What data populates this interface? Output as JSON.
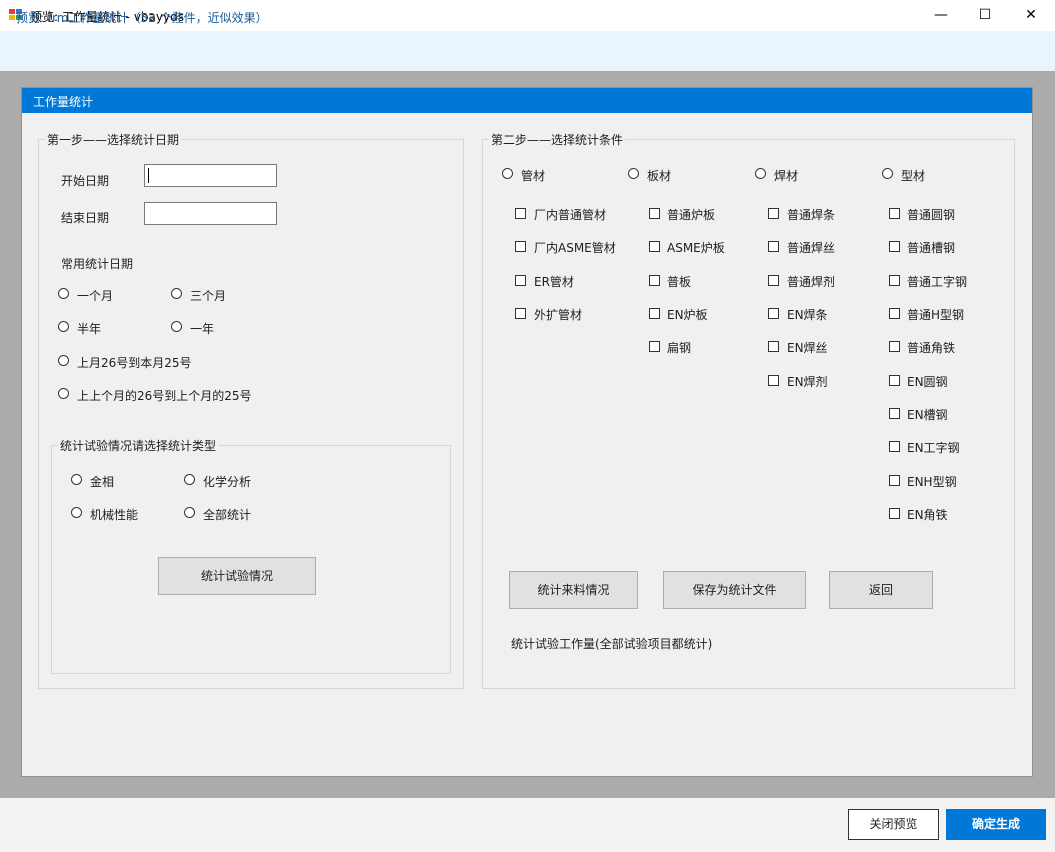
{
  "window": {
    "title": "预览: 工作量统计 - vbayyds",
    "minimize": "—",
    "maximize": "☐",
    "close": "✕"
  },
  "infobar": {
    "text": "预览: frm工作量统计（52 个控件，近似效果）"
  },
  "form": {
    "title": "工作量统计",
    "step1": {
      "title": "第一步——选择统计日期",
      "start_label": "开始日期",
      "start_value": "",
      "end_label": "结束日期",
      "end_value": "",
      "common_label": "常用统计日期",
      "ranges": [
        "一个月",
        "三个月",
        "半年",
        "一年",
        "上月26号到本月25号",
        "上上个月的26号到上个月的25号"
      ],
      "test": {
        "title": "统计试验情况请选择统计类型",
        "options": [
          "金相",
          "化学分析",
          "机械性能",
          "全部统计"
        ],
        "button": "统计试验情况"
      }
    },
    "step2": {
      "title": "第二步——选择统计条件",
      "categories": [
        "管材",
        "板材",
        "焊材",
        "型材"
      ],
      "pipe_items": [
        "厂内普通管材",
        "厂内ASME管材",
        "ER管材",
        "外扩管材"
      ],
      "plate_items": [
        "普通炉板",
        "ASME炉板",
        "普板",
        "EN炉板",
        "扁钢"
      ],
      "weld_items": [
        "普通焊条",
        "普通焊丝",
        "普通焊剂",
        "EN焊条",
        "EN焊丝",
        "EN焊剂"
      ],
      "profile_items": [
        "普通圆钢",
        "普通槽钢",
        "普通工字钢",
        "普通H型钢",
        "普通角铁",
        "EN圆钢",
        "EN槽钢",
        "EN工字钢",
        "ENH型钢",
        "EN角铁"
      ],
      "btn_incoming": "统计来料情况",
      "btn_save": "保存为统计文件",
      "btn_back": "返回",
      "note": "统计试验工作量(全部试验项目都统计)"
    }
  },
  "bottom": {
    "close_label": "关闭预览",
    "confirm_label": "确定生成"
  },
  "colors": {
    "accent": "#0078d7",
    "info_bg": "#eaf4fd",
    "form_bg": "#f0f0f0"
  }
}
